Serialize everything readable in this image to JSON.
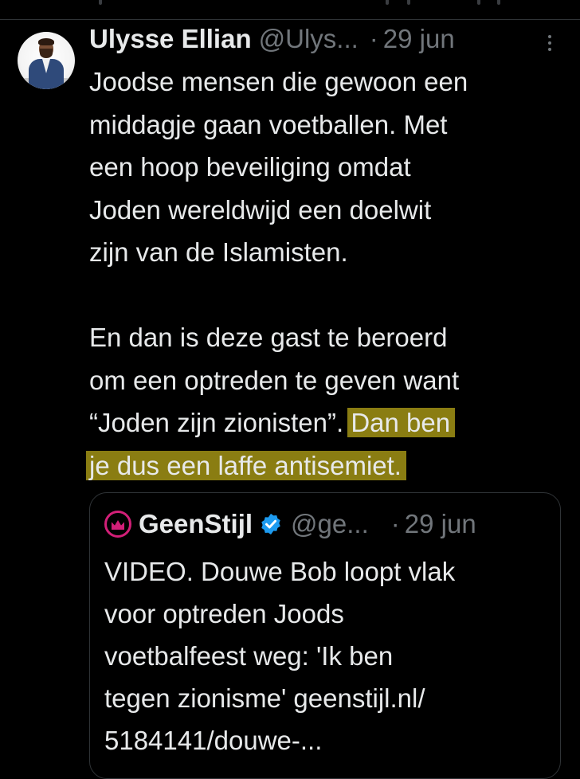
{
  "tweet": {
    "author_name": "Ulysse Ellian",
    "author_handle": "@Ulys...",
    "separator": "·",
    "date": "29 jun",
    "paragraph1_lines": [
      "Joodse mensen die gewoon een",
      "middagje gaan voetballen. Met",
      "een hoop beveiliging omdat",
      "Joden wereldwijd een doelwit",
      "zijn van de Islamisten."
    ],
    "paragraph2_lines": [
      "En dan is deze gast te beroerd",
      "om een optreden te geven want"
    ],
    "line3_plain": "“Joden zijn zionisten”. ",
    "line3_highlight": "Dan ben",
    "line4_highlight": "je dus een laffe antisemiet.",
    "highlight_color": "#8a7d12"
  },
  "quoted_tweet": {
    "author_name": "GeenStijl",
    "author_handle": "@ge...",
    "separator": "·",
    "date": "29 jun",
    "brand_color": "#d21f78",
    "verified_color": "#1d9bf0",
    "text_lines": [
      "VIDEO. Douwe Bob loopt vlak",
      "voor optreden Joods",
      "voetbalfeest weg: 'Ik ben",
      "tegen zionisme' geenstijl.nl/",
      "5184141/douwe-..."
    ]
  },
  "icons": {
    "more": "more-vertical-icon",
    "verified": "verified-badge-icon",
    "quoted_logo": "geenstijl-crown-logo"
  }
}
